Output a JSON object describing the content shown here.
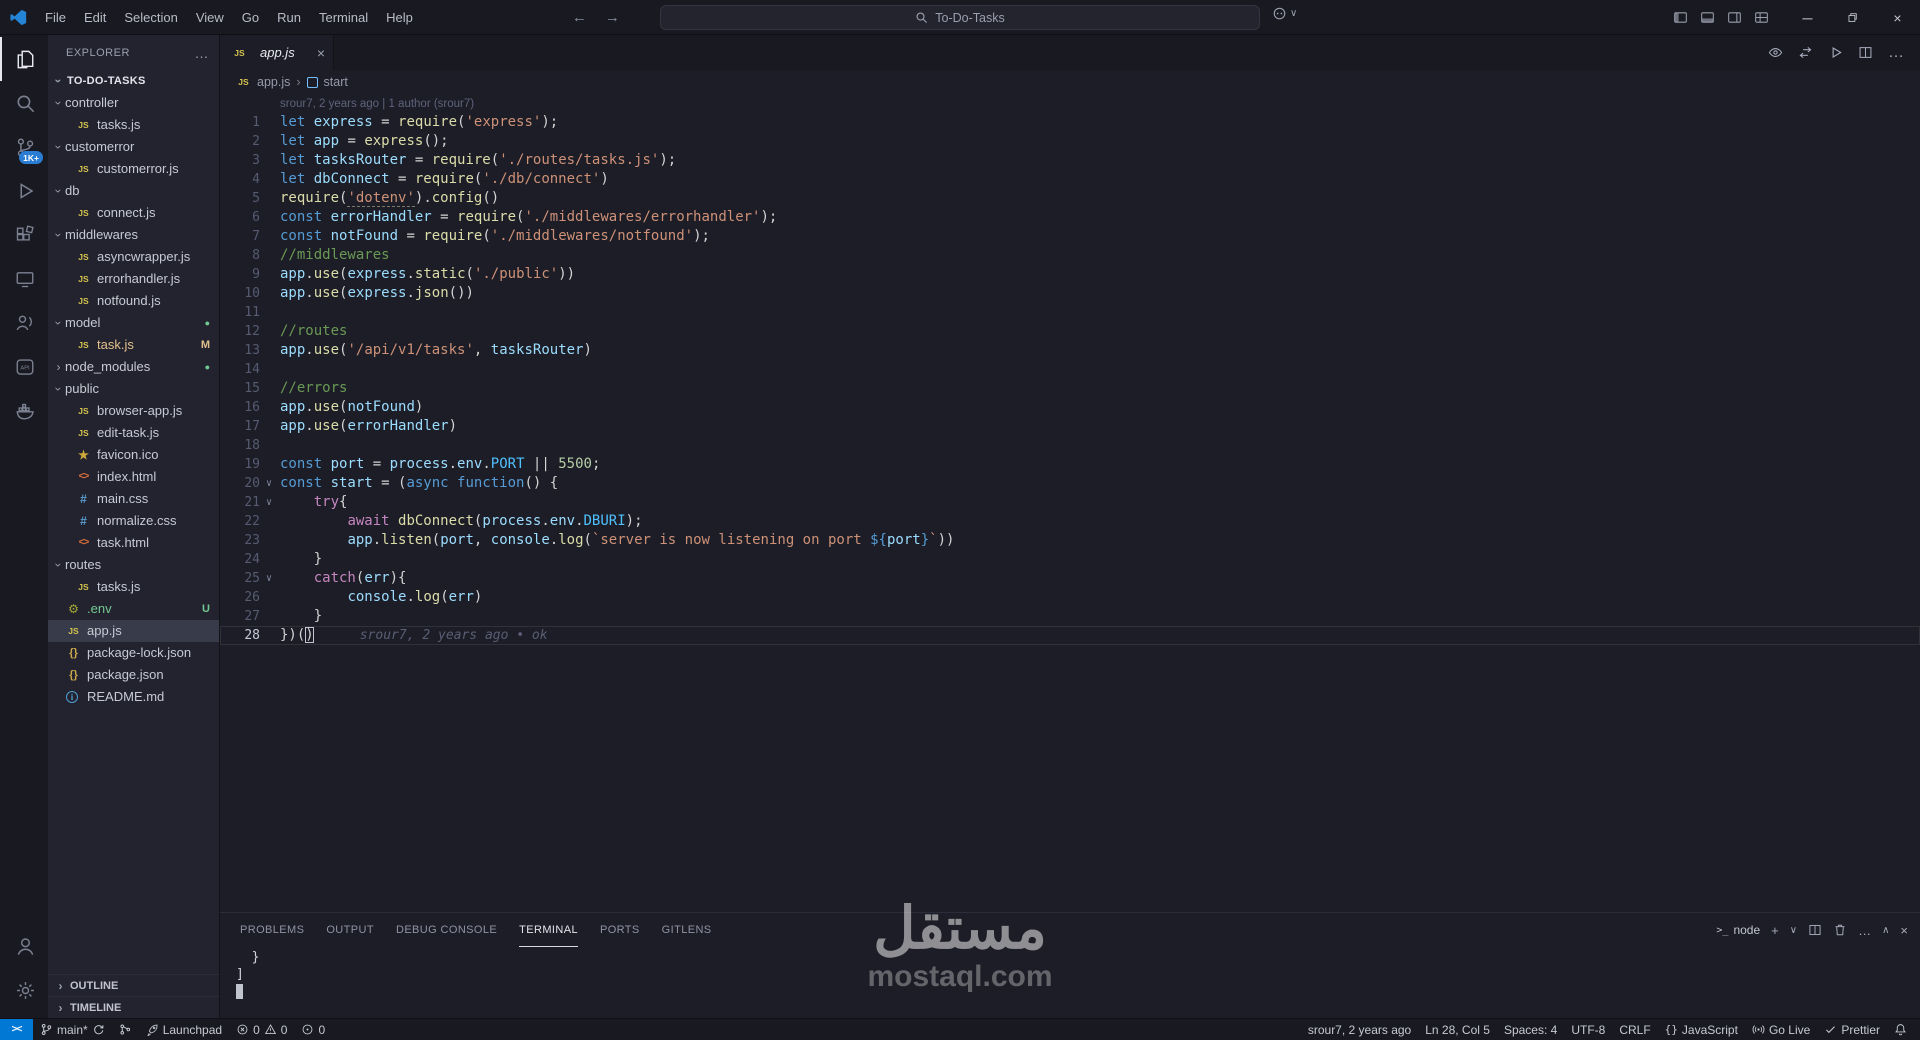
{
  "title_bar": {
    "menus": [
      "File",
      "Edit",
      "Selection",
      "View",
      "Go",
      "Run",
      "Terminal",
      "Help"
    ],
    "search_text": "To-Do-Tasks"
  },
  "activity_bar": {
    "source_control_badge": "1K+"
  },
  "glyphs": {
    "chevron": "›",
    "fold": "∨",
    "more": "…",
    "close": "×",
    "minimize": "─",
    "js": "JS",
    "json": "{}",
    "html": "<>",
    "css": "#",
    "star": "★",
    "info": "i",
    "env": "⚙",
    "plus": "+",
    "chev_down": "∨",
    "chev_up": "∧",
    "back": "←",
    "forward": "→",
    "remote": "><"
  },
  "explorer": {
    "title": "EXPLORER",
    "root": "TO-DO-TASKS",
    "files": [
      {
        "label": "controller",
        "type": "folder",
        "state": "expanded",
        "depth": 0
      },
      {
        "label": "tasks.js",
        "type": "js",
        "depth": 1
      },
      {
        "label": "customerror",
        "type": "folder",
        "state": "expanded",
        "depth": 0
      },
      {
        "label": "customerror.js",
        "type": "js",
        "depth": 1
      },
      {
        "label": "db",
        "type": "folder",
        "state": "expanded",
        "depth": 0
      },
      {
        "label": "connect.js",
        "type": "js",
        "depth": 1
      },
      {
        "label": "middlewares",
        "type": "folder",
        "state": "expanded",
        "depth": 0
      },
      {
        "label": "asyncwrapper.js",
        "type": "js",
        "depth": 1
      },
      {
        "label": "errorhandler.js",
        "type": "js",
        "depth": 1
      },
      {
        "label": "notfound.js",
        "type": "js",
        "depth": 1
      },
      {
        "label": "model",
        "type": "folder",
        "state": "expanded",
        "depth": 0,
        "badge": "dot"
      },
      {
        "label": "task.js",
        "type": "js",
        "depth": 1,
        "badge": "M",
        "color": "modified"
      },
      {
        "label": "node_modules",
        "type": "folder",
        "state": "collapsed",
        "depth": 0,
        "badge": "dot"
      },
      {
        "label": "public",
        "type": "folder",
        "state": "expanded",
        "depth": 0
      },
      {
        "label": "browser-app.js",
        "type": "js",
        "depth": 1
      },
      {
        "label": "edit-task.js",
        "type": "js",
        "depth": 1
      },
      {
        "label": "favicon.ico",
        "type": "star",
        "depth": 1
      },
      {
        "label": "index.html",
        "type": "html",
        "depth": 1
      },
      {
        "label": "main.css",
        "type": "css",
        "depth": 1
      },
      {
        "label": "normalize.css",
        "type": "css",
        "depth": 1
      },
      {
        "label": "task.html",
        "type": "html",
        "depth": 1
      },
      {
        "label": "routes",
        "type": "folder",
        "state": "expanded",
        "depth": 0
      },
      {
        "label": "tasks.js",
        "type": "js",
        "depth": 1
      },
      {
        "label": ".env",
        "type": "env",
        "depth": 0,
        "badge": "U",
        "color": "untracked"
      },
      {
        "label": "app.js",
        "type": "js",
        "depth": 0,
        "selected": true
      },
      {
        "label": "package-lock.json",
        "type": "json",
        "depth": 0
      },
      {
        "label": "package.json",
        "type": "json",
        "depth": 0
      },
      {
        "label": "README.md",
        "type": "info",
        "depth": 0
      }
    ],
    "sections": [
      "OUTLINE",
      "TIMELINE"
    ]
  },
  "editor": {
    "tab": "app.js",
    "breadcrumb_file": "app.js",
    "breadcrumb_symbol": "start",
    "codelens": "srour7, 2 years ago | 1 author (srour7)",
    "lines": [
      {
        "n": 1,
        "t": [
          [
            "k",
            "let "
          ],
          [
            "v",
            "express"
          ],
          [
            "p",
            " = "
          ],
          [
            "fn",
            "require"
          ],
          [
            "p",
            "("
          ],
          [
            "s",
            "'express'"
          ],
          [
            "p",
            ");"
          ]
        ]
      },
      {
        "n": 2,
        "t": [
          [
            "k",
            "let "
          ],
          [
            "v",
            "app"
          ],
          [
            "p",
            " = "
          ],
          [
            "fn",
            "express"
          ],
          [
            "p",
            "();"
          ]
        ]
      },
      {
        "n": 3,
        "t": [
          [
            "k",
            "let "
          ],
          [
            "v",
            "tasksRouter"
          ],
          [
            "p",
            " = "
          ],
          [
            "fn",
            "require"
          ],
          [
            "p",
            "("
          ],
          [
            "s",
            "'./routes/tasks.js'"
          ],
          [
            "p",
            ");"
          ]
        ]
      },
      {
        "n": 4,
        "t": [
          [
            "k",
            "let "
          ],
          [
            "v",
            "dbConnect"
          ],
          [
            "p",
            " = "
          ],
          [
            "fn",
            "require"
          ],
          [
            "p",
            "("
          ],
          [
            "s",
            "'./db/connect'"
          ],
          [
            "p",
            ")"
          ]
        ]
      },
      {
        "n": 5,
        "t": [
          [
            "fn",
            "require"
          ],
          [
            "p",
            "("
          ],
          [
            "su",
            "'dotenv'"
          ],
          [
            "p",
            ")."
          ],
          [
            "fn",
            "config"
          ],
          [
            "p",
            "()"
          ]
        ]
      },
      {
        "n": 6,
        "t": [
          [
            "k",
            "const "
          ],
          [
            "v",
            "errorHandler"
          ],
          [
            "p",
            " = "
          ],
          [
            "fn",
            "require"
          ],
          [
            "p",
            "("
          ],
          [
            "s",
            "'./middlewares/errorhandler'"
          ],
          [
            "p",
            ");"
          ]
        ]
      },
      {
        "n": 7,
        "t": [
          [
            "k",
            "const "
          ],
          [
            "v",
            "notFound"
          ],
          [
            "p",
            " = "
          ],
          [
            "fn",
            "require"
          ],
          [
            "p",
            "("
          ],
          [
            "s",
            "'./middlewares/notfound'"
          ],
          [
            "p",
            ");"
          ]
        ]
      },
      {
        "n": 8,
        "t": [
          [
            "c",
            "//middlewares"
          ]
        ]
      },
      {
        "n": 9,
        "t": [
          [
            "v",
            "app"
          ],
          [
            "p",
            "."
          ],
          [
            "fn",
            "use"
          ],
          [
            "p",
            "("
          ],
          [
            "v",
            "express"
          ],
          [
            "p",
            "."
          ],
          [
            "fn",
            "static"
          ],
          [
            "p",
            "("
          ],
          [
            "s",
            "'./public'"
          ],
          [
            "p",
            "))"
          ]
        ]
      },
      {
        "n": 10,
        "t": [
          [
            "v",
            "app"
          ],
          [
            "p",
            "."
          ],
          [
            "fn",
            "use"
          ],
          [
            "p",
            "("
          ],
          [
            "v",
            "express"
          ],
          [
            "p",
            "."
          ],
          [
            "fn",
            "json"
          ],
          [
            "p",
            "())"
          ]
        ]
      },
      {
        "n": 11,
        "t": []
      },
      {
        "n": 12,
        "t": [
          [
            "c",
            "//routes"
          ]
        ]
      },
      {
        "n": 13,
        "t": [
          [
            "v",
            "app"
          ],
          [
            "p",
            "."
          ],
          [
            "fn",
            "use"
          ],
          [
            "p",
            "("
          ],
          [
            "s",
            "'/api/v1/tasks'"
          ],
          [
            "p",
            ", "
          ],
          [
            "v",
            "tasksRouter"
          ],
          [
            "p",
            ")"
          ]
        ]
      },
      {
        "n": 14,
        "t": []
      },
      {
        "n": 15,
        "t": [
          [
            "c",
            "//errors"
          ]
        ]
      },
      {
        "n": 16,
        "t": [
          [
            "v",
            "app"
          ],
          [
            "p",
            "."
          ],
          [
            "fn",
            "use"
          ],
          [
            "p",
            "("
          ],
          [
            "v",
            "notFound"
          ],
          [
            "p",
            ")"
          ]
        ]
      },
      {
        "n": 17,
        "t": [
          [
            "v",
            "app"
          ],
          [
            "p",
            "."
          ],
          [
            "fn",
            "use"
          ],
          [
            "p",
            "("
          ],
          [
            "v",
            "errorHandler"
          ],
          [
            "p",
            ")"
          ]
        ]
      },
      {
        "n": 18,
        "t": []
      },
      {
        "n": 19,
        "t": [
          [
            "k",
            "const "
          ],
          [
            "v",
            "port"
          ],
          [
            "p",
            " = "
          ],
          [
            "v",
            "process"
          ],
          [
            "p",
            "."
          ],
          [
            "v",
            "env"
          ],
          [
            "p",
            "."
          ],
          [
            "cst",
            "PORT"
          ],
          [
            "p",
            " || "
          ],
          [
            "n",
            "5500"
          ],
          [
            "p",
            ";"
          ]
        ]
      },
      {
        "n": 20,
        "fold": true,
        "t": [
          [
            "k",
            "const "
          ],
          [
            "v",
            "start"
          ],
          [
            "p",
            " = ("
          ],
          [
            "k",
            "async "
          ],
          [
            "k",
            "function"
          ],
          [
            "p",
            "() {"
          ]
        ]
      },
      {
        "n": 21,
        "fold": true,
        "t": [
          [
            "p",
            "    "
          ],
          [
            "ctrl",
            "try"
          ],
          [
            "p",
            "{"
          ]
        ]
      },
      {
        "n": 22,
        "t": [
          [
            "p",
            "        "
          ],
          [
            "ctrl",
            "await "
          ],
          [
            "fn",
            "dbConnect"
          ],
          [
            "p",
            "("
          ],
          [
            "v",
            "process"
          ],
          [
            "p",
            "."
          ],
          [
            "v",
            "env"
          ],
          [
            "p",
            "."
          ],
          [
            "cst",
            "DBURI"
          ],
          [
            "p",
            ");"
          ]
        ]
      },
      {
        "n": 23,
        "t": [
          [
            "p",
            "        "
          ],
          [
            "v",
            "app"
          ],
          [
            "p",
            "."
          ],
          [
            "fn",
            "listen"
          ],
          [
            "p",
            "("
          ],
          [
            "v",
            "port"
          ],
          [
            "p",
            ", "
          ],
          [
            "v",
            "console"
          ],
          [
            "p",
            "."
          ],
          [
            "fn",
            "log"
          ],
          [
            "p",
            "("
          ],
          [
            "s",
            "`server is now listening on port "
          ],
          [
            "k",
            "${"
          ],
          [
            "v",
            "port"
          ],
          [
            "k",
            "}"
          ],
          [
            "s",
            "`"
          ],
          [
            "p",
            "))"
          ]
        ]
      },
      {
        "n": 24,
        "t": [
          [
            "p",
            "    }"
          ]
        ]
      },
      {
        "n": 25,
        "fold": true,
        "t": [
          [
            "p",
            "    "
          ],
          [
            "ctrl",
            "catch"
          ],
          [
            "p",
            "("
          ],
          [
            "v",
            "err"
          ],
          [
            "p",
            "){"
          ]
        ]
      },
      {
        "n": 26,
        "t": [
          [
            "p",
            "        "
          ],
          [
            "v",
            "console"
          ],
          [
            "p",
            "."
          ],
          [
            "fn",
            "log"
          ],
          [
            "p",
            "("
          ],
          [
            "v",
            "err"
          ],
          [
            "p",
            ")"
          ]
        ]
      },
      {
        "n": 27,
        "t": [
          [
            "p",
            "    }"
          ]
        ]
      },
      {
        "n": 28,
        "current": true,
        "blame": "srour7, 2 years ago • ok",
        "t": [
          [
            "p",
            "})("
          ],
          [
            "cur",
            ")"
          ]
        ]
      }
    ]
  },
  "panel": {
    "tabs": [
      "PROBLEMS",
      "OUTPUT",
      "DEBUG CONSOLE",
      "TERMINAL",
      "PORTS",
      "GITLENS"
    ],
    "active_tab": "TERMINAL",
    "shell_label": "node",
    "terminal_lines": [
      "  }",
      "]"
    ]
  },
  "status_bar": {
    "remote": "><",
    "branch": "main*",
    "launchpad": "Launchpad",
    "errors": "0",
    "warnings": "0",
    "misc_count": "0",
    "blame": "srour7, 2 years ago",
    "cursor": "Ln 28, Col 5",
    "indent": "Spaces: 4",
    "encoding": "UTF-8",
    "eol": "CRLF",
    "lang_icon": "{}",
    "language": "JavaScript",
    "go_live": "Go Live",
    "formatter": "Prettier"
  },
  "watermark": {
    "arabic": "مستقل",
    "latin": "mostaql.com"
  }
}
